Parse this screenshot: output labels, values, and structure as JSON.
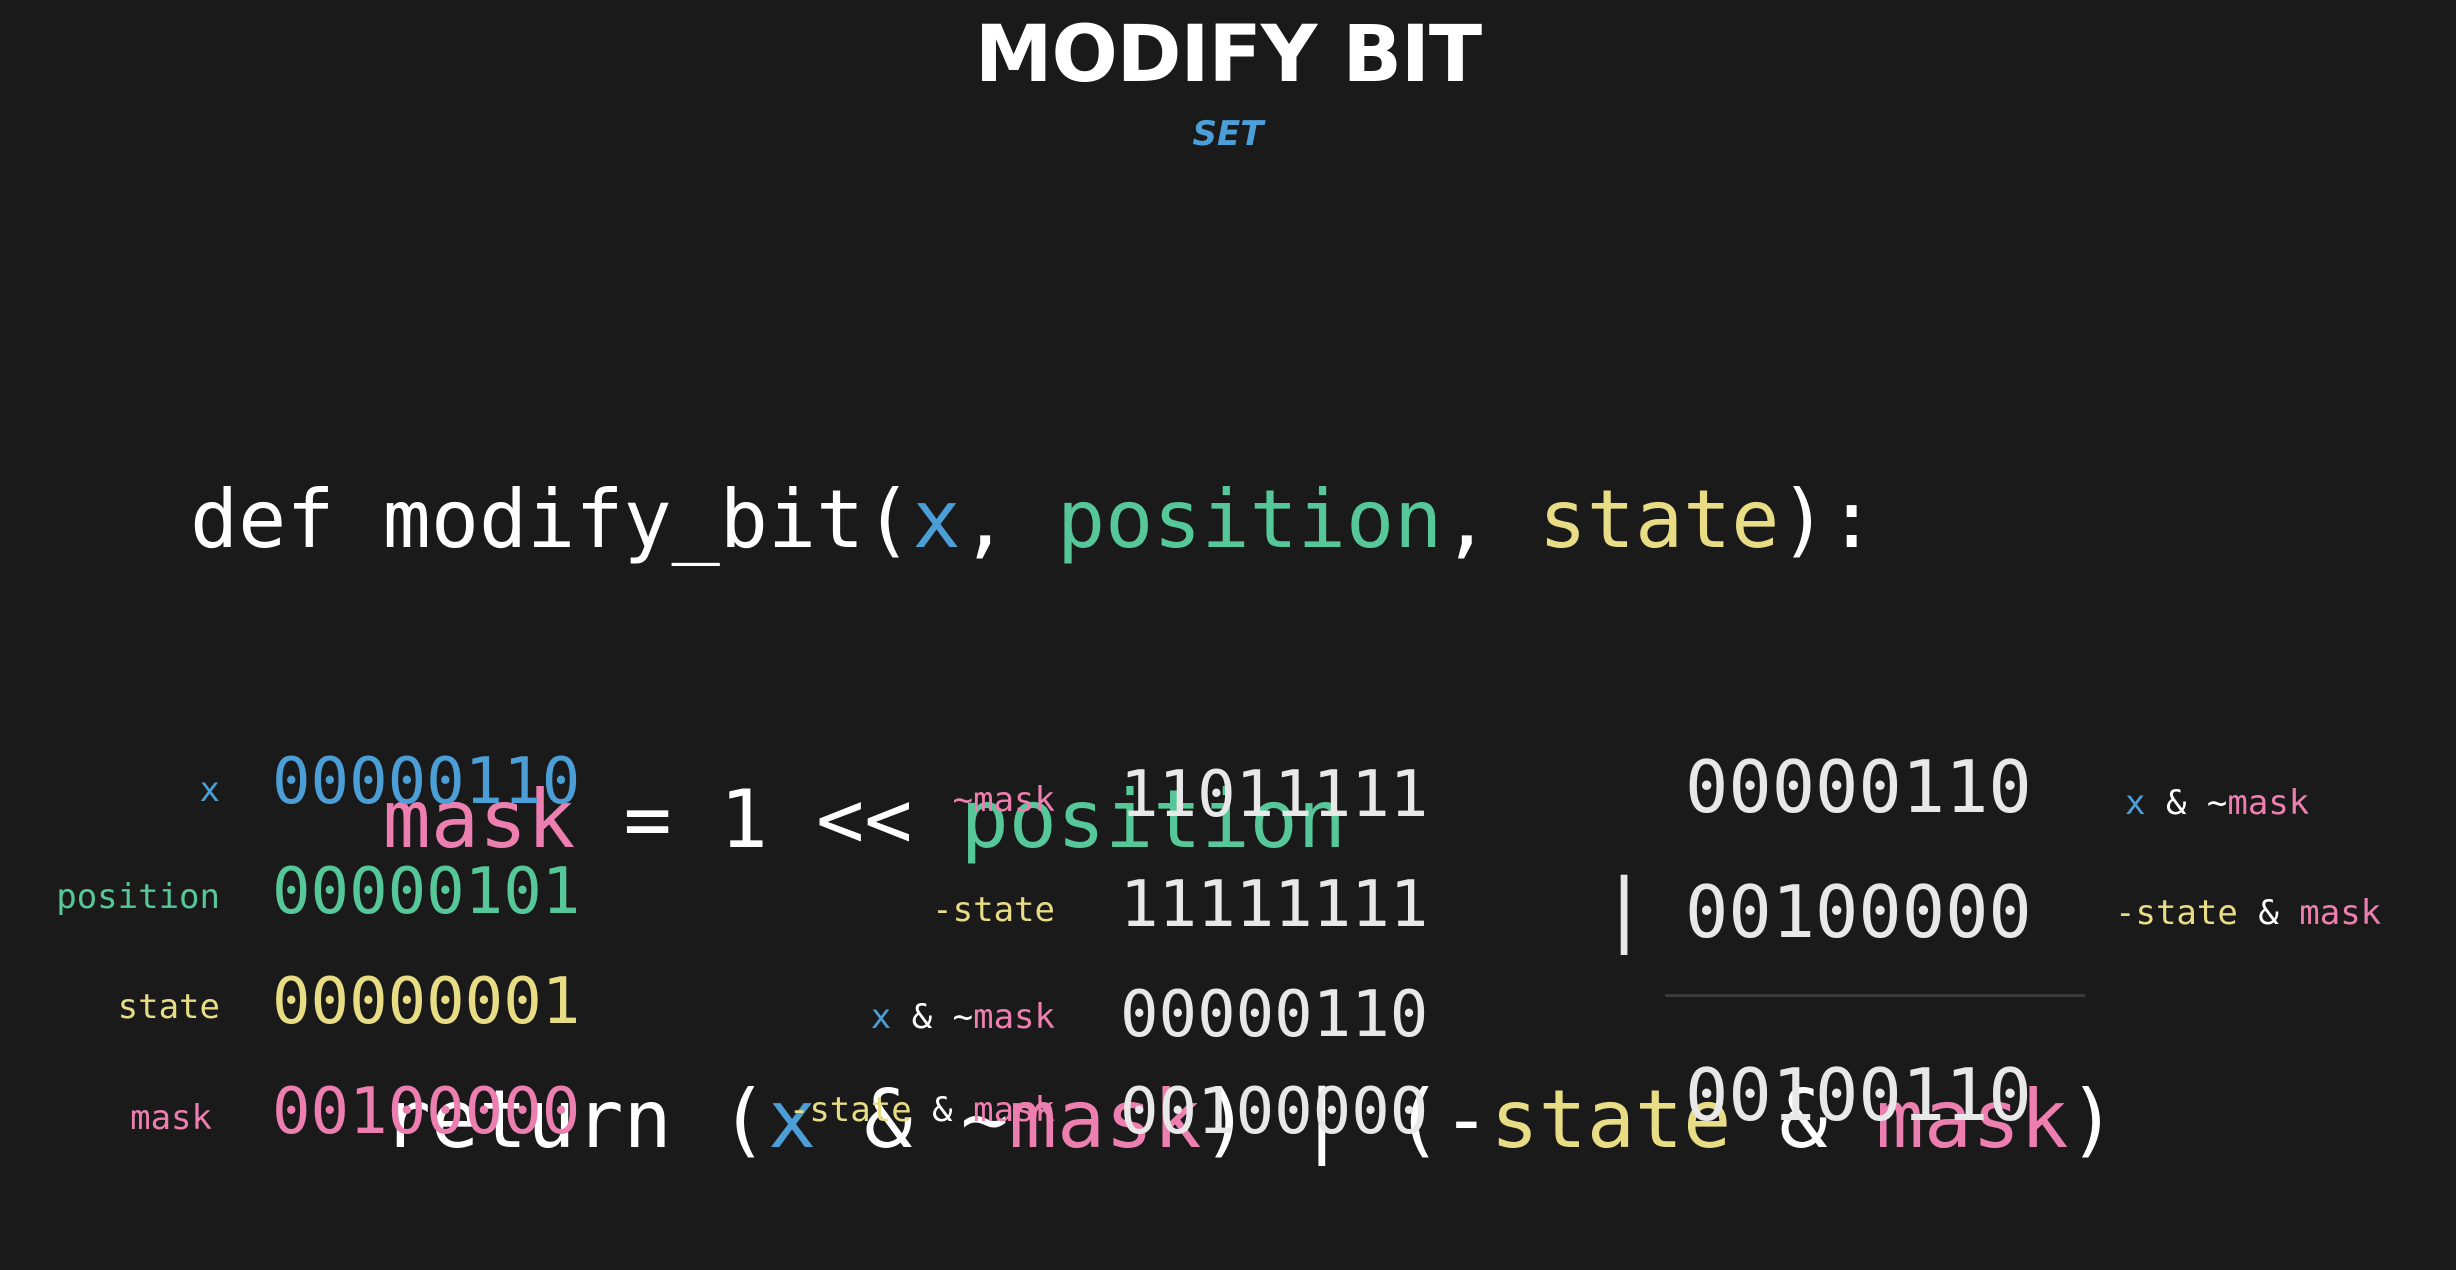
{
  "title": "MODIFY BIT",
  "subtitle": "SET",
  "code": {
    "line1": {
      "def": "def ",
      "fname": "modify_bit(",
      "x": "x",
      "comma1": ", ",
      "position": "position",
      "comma2": ", ",
      "state": "state",
      "end": "):"
    },
    "line2": {
      "indent": "    ",
      "mask": "mask",
      "op": " = 1 << ",
      "position": "position"
    },
    "line3": {
      "indent": "    ",
      "ret": "return (",
      "x": "x",
      "and1": " & ~",
      "mask1": "mask",
      "mid": ") | (-",
      "state": "state",
      "and2": " & ",
      "mask2": "mask",
      "close": ")"
    }
  },
  "left_table": [
    {
      "label": "x",
      "bits": "00000110",
      "color": "#4b9fd6"
    },
    {
      "label": "position",
      "bits": "00000101",
      "color": "#56c799"
    },
    {
      "label": "state",
      "bits": "00000001",
      "color": "#e8dc85"
    },
    {
      "label": "mask",
      "bits": "00100000",
      "color": "#ec7fb0"
    }
  ],
  "mid_table": {
    "row1": {
      "tilde": "~",
      "mask": "mask",
      "bits": "11011111"
    },
    "row2": {
      "minus": "-",
      "state": "state",
      "bits": "11111111"
    },
    "row3": {
      "x": "x",
      "amp": " & ~",
      "mask": "mask",
      "bits": "00000110"
    },
    "row4": {
      "minus": "-",
      "state": "state",
      "amp": " & ",
      "mask": "mask",
      "bits": "00100000"
    }
  },
  "right_table": {
    "row1": {
      "bits": "00000110",
      "x": "x",
      "amp": " & ~",
      "mask": "mask"
    },
    "pipe": "|",
    "row2": {
      "bits": "00100000",
      "minus": "-",
      "state": "state",
      "amp": " & ",
      "mask": "mask"
    },
    "result": "00100110"
  },
  "colors": {
    "background": "#1a1a1a",
    "x": "#4b9fd6",
    "position": "#56c799",
    "state": "#e8dc85",
    "mask": "#ec7fb0"
  }
}
